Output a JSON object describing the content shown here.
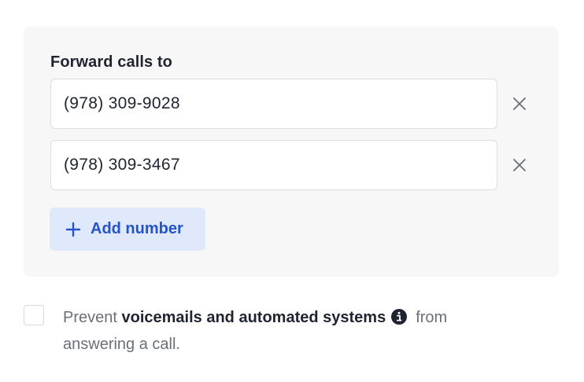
{
  "forward": {
    "label": "Forward calls to",
    "numbers": [
      {
        "value": "(978) 309-9028",
        "remove_icon": "close-icon"
      },
      {
        "value": "(978) 309-3467",
        "remove_icon": "close-icon"
      }
    ],
    "add_label": "Add number",
    "add_icon": "plus-icon"
  },
  "prevent": {
    "checked": false,
    "text_before": "Prevent",
    "text_bold": "voicemails and automated systems",
    "info_icon": "info-icon",
    "text_after_line1": "from",
    "text_after_line2": "answering a call."
  },
  "colors": {
    "panel_bg": "#f7f7f8",
    "accent": "#2454c8",
    "accent_bg": "#dfe9fb",
    "text": "#1f2430",
    "muted_text": "#6b6f78"
  }
}
